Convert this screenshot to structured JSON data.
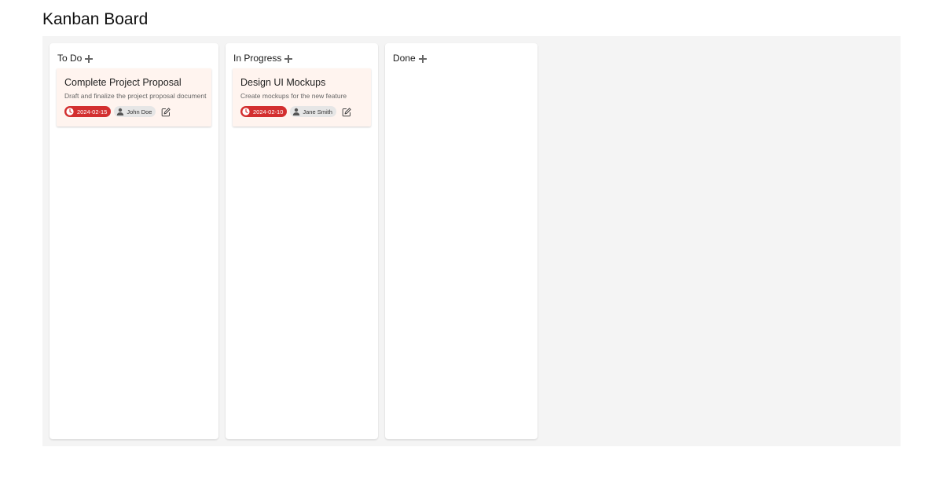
{
  "page": {
    "title": "Kanban Board"
  },
  "columns": [
    {
      "title": "To Do",
      "cards": [
        {
          "title": "Complete Project Proposal",
          "description": "Draft and finalize the project proposal document",
          "due_date": "2024-02-15",
          "assignee": "John Doe"
        }
      ]
    },
    {
      "title": "In Progress",
      "cards": [
        {
          "title": "Design UI Mockups",
          "description": "Create mockups for the new feature",
          "due_date": "2024-02-10",
          "assignee": "Jane Smith"
        }
      ]
    },
    {
      "title": "Done",
      "cards": []
    }
  ],
  "icons": {
    "add": "plus-icon",
    "due": "clock-icon",
    "assignee": "person-icon",
    "edit": "edit-icon"
  },
  "colors": {
    "board_bg": "#f4f4f4",
    "card_bg": "#fff4ef",
    "due_chip": "#d32f2f",
    "assignee_chip": "#e6e6e6"
  }
}
